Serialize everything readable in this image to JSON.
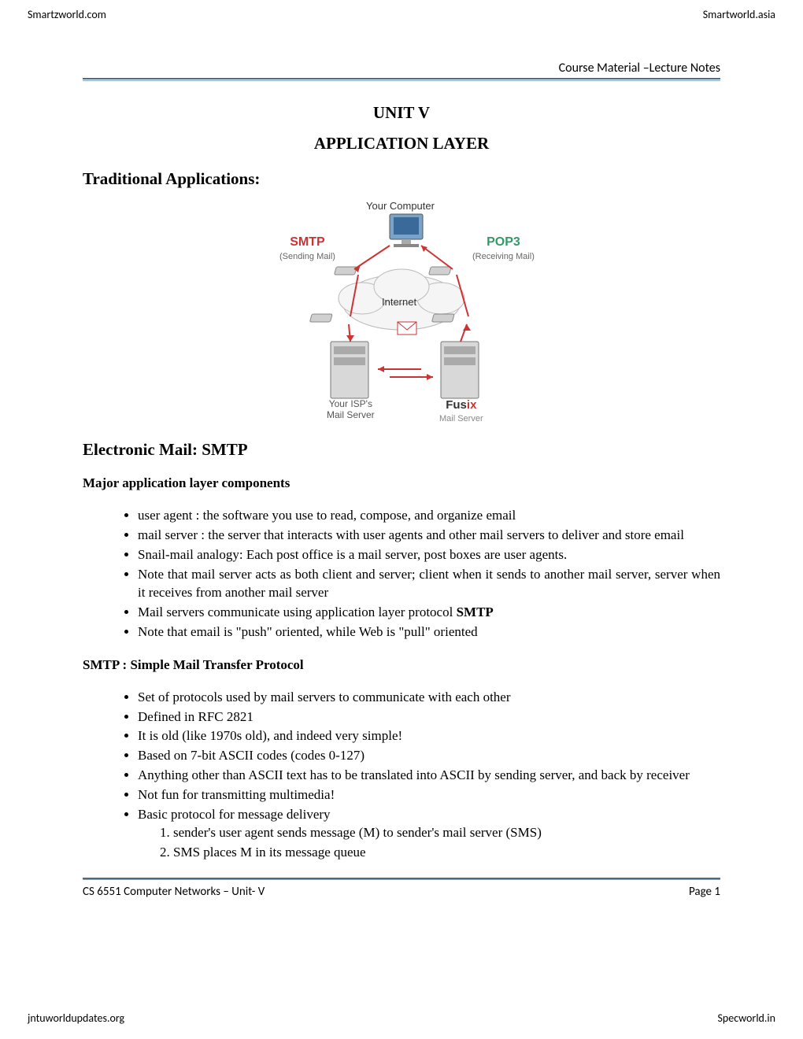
{
  "top_header": {
    "left": "Smartzworld.com",
    "right": "Smartworld.asia"
  },
  "course_header": "Course Material –Lecture Notes",
  "unit_title": "UNIT V",
  "chapter_title": "APPLICATION LAYER",
  "section_title": "Traditional Applications:",
  "diagram": {
    "your_computer": "Your Computer",
    "smtp_label": "SMTP",
    "smtp_sub": "(Sending Mail)",
    "pop3_label": "POP3",
    "pop3_sub": "(Receiving Mail)",
    "internet": "Internet",
    "isp_line1": "Your ISP's",
    "isp_line2": "Mail Server",
    "fusix_label": "Fusix",
    "fusix_sub": "Mail Server"
  },
  "subsection_title": "Electronic Mail: SMTP",
  "major_heading": "Major application layer components",
  "major_list": [
    "user agent : the software you use to read, compose, and organize email",
    "mail server : the server that interacts with user agents and other mail servers to deliver and store email",
    "Snail-mail analogy: Each post office is a mail server, post boxes are user agents.",
    "Note that mail server acts as both client and server; client when it sends to another mail server, server when it receives from another mail server",
    "Mail servers communicate using application layer protocol ",
    "Note that email is \"push\" oriented, while Web is \"pull\" oriented"
  ],
  "smtp_bold": "SMTP",
  "smtp_heading": "SMTP : Simple Mail Transfer Protocol",
  "smtp_list": [
    "Set of protocols used by mail servers to communicate with each other",
    "Defined in RFC 2821",
    "It is old (like 1970s old), and indeed very simple!",
    "Based on 7-bit ASCII codes (codes 0-127)",
    "Anything other than ASCII text has to be translated into ASCII by sending server, and back by receiver",
    "Not fun for transmitting multimedia!",
    "Basic protocol for message delivery"
  ],
  "protocol_steps": [
    "sender's user agent sends message (M) to sender's mail server (SMS)",
    "SMS places M in its message queue"
  ],
  "footer": {
    "left": "CS 6551 Computer Networks – Unit- V",
    "right": "Page 1"
  },
  "bottom_footer": {
    "left": "jntuworldupdates.org",
    "right": "Specworld.in"
  }
}
